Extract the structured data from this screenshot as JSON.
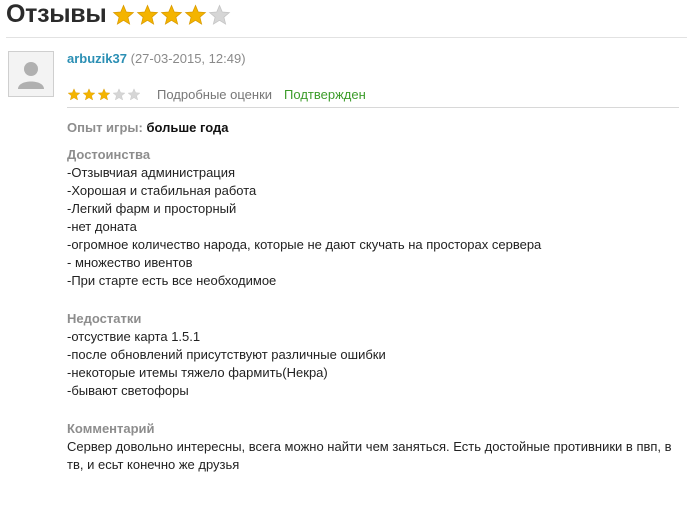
{
  "header": {
    "title": "Отзывы",
    "overall_rating": {
      "filled": 4,
      "max": 5,
      "star_color": "#f4b400",
      "empty_color": "#d6d6d6"
    }
  },
  "review": {
    "author": "arbuzik37",
    "date": "(27-03-2015, 12:49)",
    "rating": {
      "filled": 3,
      "max": 5
    },
    "detailed_link": "Подробные оценки",
    "verified_label": "Подтвержден",
    "experience_label": "Опыт игры:",
    "experience_value": "больше года",
    "pros": {
      "title": "Достоинства",
      "lines": [
        "-Отзывчиая администрация",
        "-Хорошая и стабильная работа",
        "-Легкий фарм и просторный",
        "-нет доната",
        "-огромное количество народа, которые не дают скучать на просторах сервера",
        "- множество ивентов",
        "-При старте есть все необходимое"
      ]
    },
    "cons": {
      "title": "Недостатки",
      "lines": [
        "-отсуствие карта 1.5.1",
        "-после обновлений присутствуют различные ошибки",
        "-некоторые итемы тяжело фармить(Некра)",
        "-бывают светофоры"
      ]
    },
    "comment": {
      "title": "Комментарий",
      "lines": [
        "Сервер довольно интересны, всега можно найти чем заняться. Есть достойные противники в пвп, в",
        "тв, и есьт конечно же друзья"
      ]
    }
  },
  "colors": {
    "author_link": "#2b8fb4",
    "verified": "#3c9c2a",
    "label_gray": "#8d8d8d"
  }
}
